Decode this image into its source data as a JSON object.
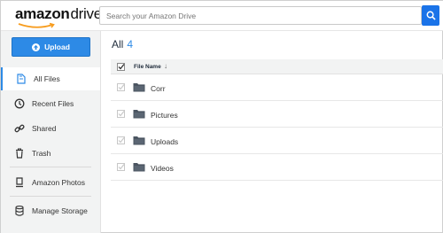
{
  "header": {
    "logo_amazon": "amazon",
    "logo_drive": "drive",
    "search_placeholder": "Search your Amazon Drive"
  },
  "sidebar": {
    "upload_label": "Upload",
    "items": [
      {
        "label": "All Files",
        "icon": "file-icon"
      },
      {
        "label": "Recent Files",
        "icon": "clock-icon"
      },
      {
        "label": "Shared",
        "icon": "link-icon"
      },
      {
        "label": "Trash",
        "icon": "trash-icon"
      },
      {
        "label": "Amazon Photos",
        "icon": "photos-icon"
      },
      {
        "label": "Manage Storage",
        "icon": "storage-icon"
      }
    ]
  },
  "main": {
    "title": "All",
    "count": "4",
    "column_header": "File Name",
    "sort_indicator": "↓",
    "rows": [
      {
        "name": "Corr"
      },
      {
        "name": "Pictures"
      },
      {
        "name": "Uploads"
      },
      {
        "name": "Videos"
      }
    ]
  },
  "colors": {
    "accent": "#2d8ae6",
    "search_button": "#1a73e8",
    "sidebar_bg": "#f2f3f3",
    "folder": "#4b5561"
  }
}
